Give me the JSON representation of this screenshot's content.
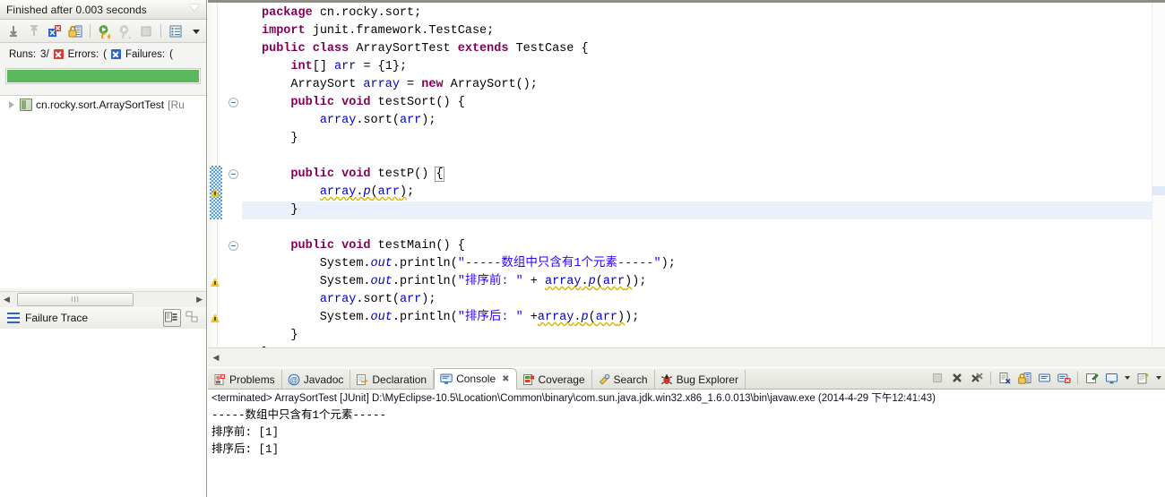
{
  "junit_view": {
    "title": "Finished after 0.003 seconds",
    "view_menu_icon": "view-menu-triangle-icon",
    "toolbar": [
      {
        "name": "next-failed-test-icon",
        "label": "Next Failed Test"
      },
      {
        "name": "previous-failed-test-icon",
        "label": "Previous Failed Test"
      },
      {
        "name": "show-failures-only-icon",
        "label": "Show Failures Only"
      },
      {
        "name": "scroll-lock-icon",
        "label": "Scroll Lock"
      },
      {
        "name": "rerun-test-icon",
        "label": "Rerun Test"
      },
      {
        "name": "rerun-failed-tests-icon",
        "label": "Rerun Test - Failures First"
      },
      {
        "name": "stop-icon",
        "label": "Stop JUnit Test Run"
      },
      {
        "name": "test-run-history-icon",
        "label": "Test Run History"
      },
      {
        "name": "view-dropdown-arrow-icon",
        "label": "View Menu"
      }
    ],
    "counters": {
      "runs_label": "Runs:",
      "runs_value": "3/",
      "errors_label": "Errors:",
      "errors_value": "(",
      "failures_label": "Failures:",
      "failures_value": "("
    },
    "progress": {
      "percent": 100,
      "color": "#5cb85c"
    },
    "tree": [
      {
        "label": "cn.rocky.sort.ArraySortTest",
        "suffix": "[Ru",
        "expander": "collapsed-arrow-icon",
        "icon": "test-class-icon"
      }
    ],
    "hscroll": {
      "left_arrow": "◀",
      "right_arrow": "▶",
      "thumb_grip": "III"
    },
    "failure_trace": {
      "label": "Failure Trace",
      "icon": "failure-trace-list-icon",
      "buttons": [
        {
          "name": "compare-result-button",
          "label": "Compare Result"
        },
        {
          "name": "stack-trace-filter-button",
          "label": "Filter Stack Trace"
        }
      ]
    }
  },
  "editor": {
    "lines": [
      {
        "id": "l1",
        "fold": false,
        "warn": false,
        "blue": false,
        "highlight": false,
        "tokens": [
          {
            "t": "package ",
            "c": "kw"
          },
          {
            "t": "cn.rocky.sort;",
            "c": ""
          }
        ]
      },
      {
        "id": "l2",
        "fold": false,
        "warn": false,
        "blue": false,
        "highlight": false,
        "tokens": [
          {
            "t": "import ",
            "c": "kw"
          },
          {
            "t": "junit.framework.TestCase;",
            "c": ""
          }
        ]
      },
      {
        "id": "l3",
        "fold": false,
        "warn": false,
        "blue": false,
        "highlight": false,
        "tokens": [
          {
            "t": "public class ",
            "c": "kw"
          },
          {
            "t": "ArraySortTest ",
            "c": ""
          },
          {
            "t": "extends ",
            "c": "kw"
          },
          {
            "t": "TestCase {",
            "c": ""
          }
        ]
      },
      {
        "id": "l4",
        "fold": false,
        "warn": false,
        "blue": false,
        "highlight": false,
        "tokens": [
          {
            "t": "    ",
            "c": ""
          },
          {
            "t": "int",
            "c": "kw"
          },
          {
            "t": "[] ",
            "c": ""
          },
          {
            "t": "arr",
            "c": "fld"
          },
          {
            "t": " = {1};",
            "c": ""
          }
        ]
      },
      {
        "id": "l5",
        "fold": false,
        "warn": false,
        "blue": false,
        "highlight": false,
        "tokens": [
          {
            "t": "    ArraySort ",
            "c": ""
          },
          {
            "t": "array",
            "c": "fld"
          },
          {
            "t": " = ",
            "c": ""
          },
          {
            "t": "new ",
            "c": "kw"
          },
          {
            "t": "ArraySort();",
            "c": ""
          }
        ]
      },
      {
        "id": "l6",
        "fold": true,
        "warn": false,
        "blue": false,
        "highlight": false,
        "tokens": [
          {
            "t": "    ",
            "c": ""
          },
          {
            "t": "public void ",
            "c": "kw"
          },
          {
            "t": "testSort() {",
            "c": ""
          }
        ]
      },
      {
        "id": "l7",
        "fold": false,
        "warn": false,
        "blue": false,
        "highlight": false,
        "tokens": [
          {
            "t": "        ",
            "c": ""
          },
          {
            "t": "array",
            "c": "fld"
          },
          {
            "t": ".sort(",
            "c": ""
          },
          {
            "t": "arr",
            "c": "fld"
          },
          {
            "t": ");",
            "c": ""
          }
        ]
      },
      {
        "id": "l8",
        "fold": false,
        "warn": false,
        "blue": false,
        "highlight": false,
        "tokens": [
          {
            "t": "    }",
            "c": ""
          }
        ]
      },
      {
        "id": "l9",
        "fold": false,
        "warn": false,
        "blue": false,
        "highlight": false,
        "tokens": [
          {
            "t": "",
            "c": ""
          }
        ]
      },
      {
        "id": "l10",
        "fold": true,
        "warn": false,
        "blue": true,
        "highlight": false,
        "tokens": [
          {
            "t": "    ",
            "c": ""
          },
          {
            "t": "public void ",
            "c": "kw"
          },
          {
            "t": "testP() ",
            "c": ""
          },
          {
            "t": "{",
            "c": "brkbox"
          }
        ]
      },
      {
        "id": "l11",
        "fold": false,
        "warn": true,
        "blue": true,
        "highlight": false,
        "tokens": [
          {
            "t": "        ",
            "c": ""
          },
          {
            "t": "array",
            "c": "fld warnu"
          },
          {
            "t": ".",
            "c": "warnu"
          },
          {
            "t": "p",
            "c": "ital warnu"
          },
          {
            "t": "(",
            "c": "warnu"
          },
          {
            "t": "arr",
            "c": "fld warnu"
          },
          {
            "t": ")",
            "c": "warnu"
          },
          {
            "t": ";",
            "c": ""
          }
        ]
      },
      {
        "id": "l12",
        "fold": false,
        "warn": false,
        "blue": true,
        "highlight": true,
        "tokens": [
          {
            "t": "    }",
            "c": ""
          }
        ]
      },
      {
        "id": "l13",
        "fold": false,
        "warn": false,
        "blue": false,
        "highlight": false,
        "tokens": [
          {
            "t": "",
            "c": ""
          }
        ]
      },
      {
        "id": "l14",
        "fold": true,
        "warn": false,
        "blue": false,
        "highlight": false,
        "tokens": [
          {
            "t": "    ",
            "c": ""
          },
          {
            "t": "public void ",
            "c": "kw"
          },
          {
            "t": "testMain() {",
            "c": ""
          }
        ]
      },
      {
        "id": "l15",
        "fold": false,
        "warn": false,
        "blue": false,
        "highlight": false,
        "tokens": [
          {
            "t": "        System.",
            "c": ""
          },
          {
            "t": "out",
            "c": "ital"
          },
          {
            "t": ".println(",
            "c": ""
          },
          {
            "t": "\"-----数组中只含有1个元素-----\"",
            "c": "str"
          },
          {
            "t": ");",
            "c": ""
          }
        ]
      },
      {
        "id": "l16",
        "fold": false,
        "warn": true,
        "blue": false,
        "highlight": false,
        "tokens": [
          {
            "t": "        System.",
            "c": ""
          },
          {
            "t": "out",
            "c": "ital"
          },
          {
            "t": ".println(",
            "c": ""
          },
          {
            "t": "\"排序前: \"",
            "c": "str"
          },
          {
            "t": " + ",
            "c": ""
          },
          {
            "t": "array",
            "c": "fld warnu"
          },
          {
            "t": ".",
            "c": "warnu"
          },
          {
            "t": "p",
            "c": "ital warnu"
          },
          {
            "t": "(",
            "c": "warnu"
          },
          {
            "t": "arr",
            "c": "fld warnu"
          },
          {
            "t": ")",
            "c": "warnu"
          },
          {
            "t": ");",
            "c": ""
          }
        ]
      },
      {
        "id": "l17",
        "fold": false,
        "warn": false,
        "blue": false,
        "highlight": false,
        "tokens": [
          {
            "t": "        ",
            "c": ""
          },
          {
            "t": "array",
            "c": "fld"
          },
          {
            "t": ".sort(",
            "c": ""
          },
          {
            "t": "arr",
            "c": "fld"
          },
          {
            "t": ");",
            "c": ""
          }
        ]
      },
      {
        "id": "l18",
        "fold": false,
        "warn": true,
        "blue": false,
        "highlight": false,
        "tokens": [
          {
            "t": "        System.",
            "c": ""
          },
          {
            "t": "out",
            "c": "ital"
          },
          {
            "t": ".println(",
            "c": ""
          },
          {
            "t": "\"排序后: \"",
            "c": "str"
          },
          {
            "t": " +",
            "c": ""
          },
          {
            "t": "array",
            "c": "fld warnu"
          },
          {
            "t": ".",
            "c": "warnu"
          },
          {
            "t": "p",
            "c": "ital warnu"
          },
          {
            "t": "(",
            "c": "warnu"
          },
          {
            "t": "arr",
            "c": "fld warnu"
          },
          {
            "t": ")",
            "c": "warnu"
          },
          {
            "t": ");",
            "c": ""
          }
        ]
      },
      {
        "id": "l19",
        "fold": false,
        "warn": false,
        "blue": false,
        "highlight": false,
        "tokens": [
          {
            "t": "    }",
            "c": ""
          }
        ]
      },
      {
        "id": "l20",
        "fold": false,
        "warn": false,
        "blue": false,
        "highlight": false,
        "tokens": [
          {
            "t": "}",
            "c": ""
          }
        ]
      }
    ],
    "hscroll": {
      "left_arrow": "◀"
    }
  },
  "console": {
    "tabs": [
      {
        "label": "Problems",
        "icon": "problems-icon",
        "active": false,
        "closable": false
      },
      {
        "label": "Javadoc",
        "icon": "javadoc-at-icon",
        "active": false,
        "closable": false
      },
      {
        "label": "Declaration",
        "icon": "declaration-icon",
        "active": false,
        "closable": false
      },
      {
        "label": "Console",
        "icon": "console-monitor-icon",
        "active": true,
        "closable": true
      },
      {
        "label": "Coverage",
        "icon": "coverage-icon",
        "active": false,
        "closable": false
      },
      {
        "label": "Search",
        "icon": "search-icon",
        "active": false,
        "closable": false
      },
      {
        "label": "Bug Explorer",
        "icon": "bug-explorer-icon",
        "active": false,
        "closable": false
      }
    ],
    "tab_close_glyph": "✖",
    "toolbar": [
      {
        "name": "terminate-button",
        "label": "Terminate"
      },
      {
        "name": "remove-launch-button",
        "label": "Remove Launch"
      },
      {
        "name": "remove-all-terminated-button",
        "label": "Remove All Terminated Launches"
      },
      {
        "name": "clear-console-button",
        "label": "Clear Console"
      },
      {
        "name": "scroll-lock-button",
        "label": "Scroll Lock"
      },
      {
        "name": "show-console-on-output-button",
        "label": "Show Console When Standard Out Changes"
      },
      {
        "name": "show-console-on-error-button",
        "label": "Show Console When Standard Error Changes"
      },
      {
        "name": "pin-console-button",
        "label": "Pin Console"
      },
      {
        "name": "display-selected-console-button",
        "label": "Display Selected Console"
      },
      {
        "name": "display-selected-console-dropdown",
        "label": "Display Selected Console Menu"
      },
      {
        "name": "open-console-button",
        "label": "Open Console"
      },
      {
        "name": "open-console-dropdown",
        "label": "Open Console Menu"
      }
    ],
    "status_line": "<terminated> ArraySortTest [JUnit] D:\\MyEclipse-10.5\\Location\\Common\\binary\\com.sun.java.jdk.win32.x86_1.6.0.013\\bin\\javaw.exe (2014-4-29 下午12:41:43)",
    "output": [
      "-----数组中只含有1个元素-----",
      "排序前: [1]",
      "排序后: [1]"
    ]
  }
}
